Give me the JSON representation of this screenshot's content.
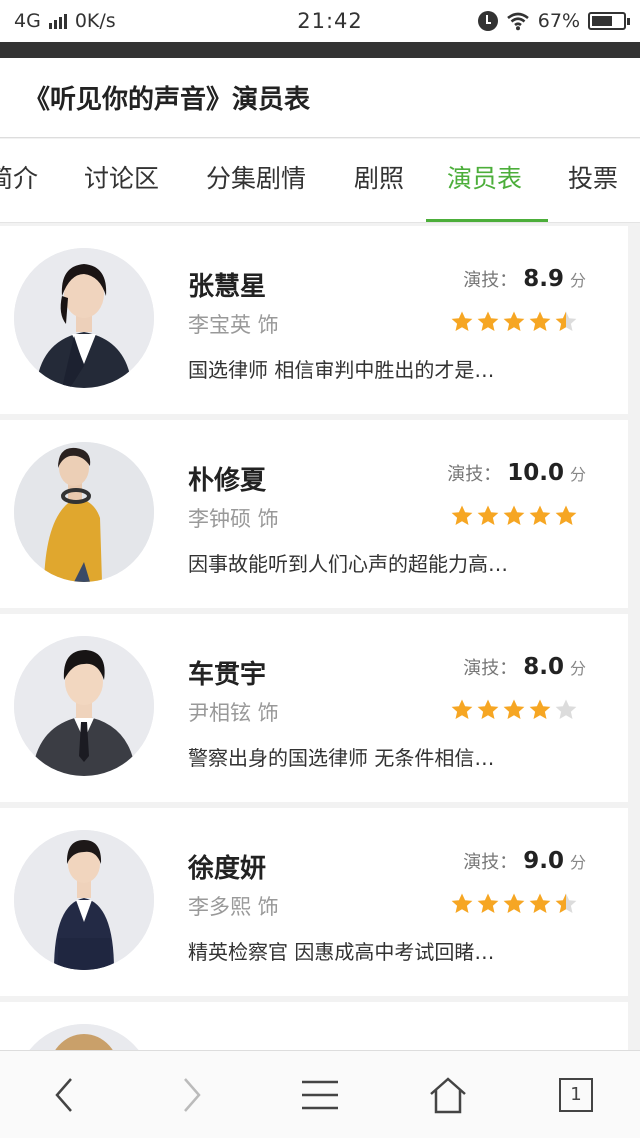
{
  "status_bar": {
    "network": "4G",
    "speed": "0K/s",
    "time": "21:42",
    "battery": "67%",
    "battery_level": 0.67
  },
  "header": {
    "title": "《听见你的声音》演员表"
  },
  "tabs": [
    {
      "label": "简介",
      "active": false
    },
    {
      "label": "讨论区",
      "active": false
    },
    {
      "label": "分集剧情",
      "active": false
    },
    {
      "label": "剧照",
      "active": false
    },
    {
      "label": "演员表",
      "active": true
    },
    {
      "label": "投票",
      "active": false
    }
  ],
  "cast": [
    {
      "actor": "张慧星",
      "role": "李宝英 饰",
      "score_label": "演技：",
      "score": "8.9",
      "score_unit": "分",
      "stars": 4.5,
      "description": "国选律师 相信审判中胜出的才是…"
    },
    {
      "actor": "朴修夏",
      "role": "李钟硕 饰",
      "score_label": "演技：",
      "score": "10.0",
      "score_unit": "分",
      "stars": 5,
      "description": "因事故能听到人们心声的超能力高…"
    },
    {
      "actor": "车贯宇",
      "role": "尹相铉 饰",
      "score_label": "演技：",
      "score": "8.0",
      "score_unit": "分",
      "stars": 4,
      "description": "警察出身的国选律师 无条件相信…"
    },
    {
      "actor": "徐度妍",
      "role": "李多熙 饰",
      "score_label": "演技：",
      "score": "9.0",
      "score_unit": "分",
      "stars": 4.5,
      "description": "精英检察官 因惠成高中考试回睹…"
    }
  ],
  "bottom_nav": {
    "back_icon": "chevron-left-icon",
    "forward_icon": "chevron-right-icon",
    "menu_icon": "hamburger-menu-icon",
    "home_icon": "home-icon",
    "tabs_count": "1"
  },
  "colors": {
    "accent": "#4cae3a",
    "star": "#f6a623",
    "star_empty": "#dcdcdc"
  }
}
